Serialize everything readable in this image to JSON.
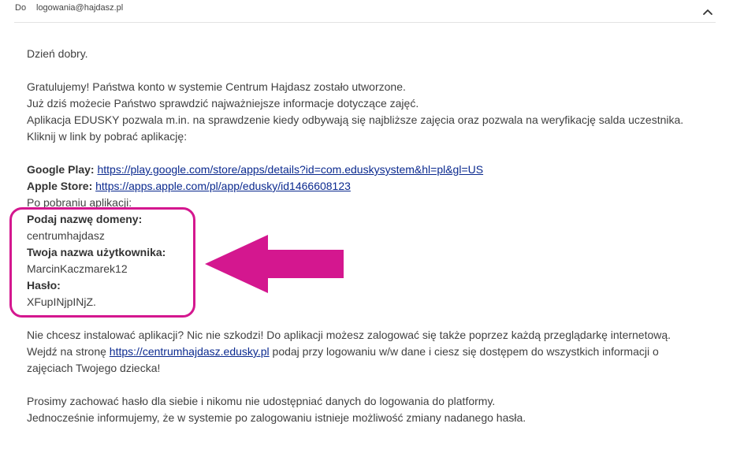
{
  "header": {
    "to_label": "Do",
    "to_address": "logowania@hajdasz.pl",
    "collapse_icon": "chevron-up-icon"
  },
  "email": {
    "greeting": "Dzień dobry.",
    "para1": [
      "Gratulujemy! Państwa konto w systemie Centrum Hajdasz zostało utworzone.",
      "Już dziś możecie Państwo sprawdzić najważniejsze informacje dotyczące zajęć.",
      "Aplikacja EDUSKY pozwala m.in. na sprawdzenie kiedy odbywają się najbliższe zajęcia oraz pozwala na weryfikację salda uczestnika.",
      "Kliknij w link by pobrać aplikację:"
    ],
    "google_play_label": "Google Play:",
    "google_play_url": "https://play.google.com/store/apps/details?id=com.eduskysystem&hl=pl&gl=US",
    "apple_store_label": "Apple Store:",
    "apple_store_url": "https://apps.apple.com/pl/app/edusky/id1466608123",
    "after_download": "Po pobraniu aplikacji:",
    "domain_label": "Podaj nazwę domeny:",
    "domain_value": "centrumhajdasz",
    "username_label": "Twoja nazwa użytkownika:",
    "username_value": "MarcinKaczmarek12",
    "password_label": "Hasło:",
    "password_value": "XFupINjpINjZ.",
    "no_install": "Nie chcesz instalować aplikacji? Nic nie szkodzi! Do aplikacji możesz zalogować się także poprzez każdą przeglądarkę internetową.",
    "visit_prefix": "Wejdź na stronę ",
    "visit_url": "https://centrumhajdasz.edusky.pl",
    "visit_suffix": " podaj przy logowaniu w/w dane i ciesz się dostępem do wszystkich informacji o",
    "visit_line2": "zajęciach Twojego dziecka!",
    "closing": [
      "Prosimy zachować hasło dla siebie i nikomu nie udostępniać danych do logowania do platformy.",
      "Jednocześnie informujemy, że w systemie po zalogowaniu istnieje możliwość zmiany nadanego hasła."
    ]
  },
  "annotation": {
    "color": "#d4178f",
    "shape": "arrow-left-icon"
  }
}
